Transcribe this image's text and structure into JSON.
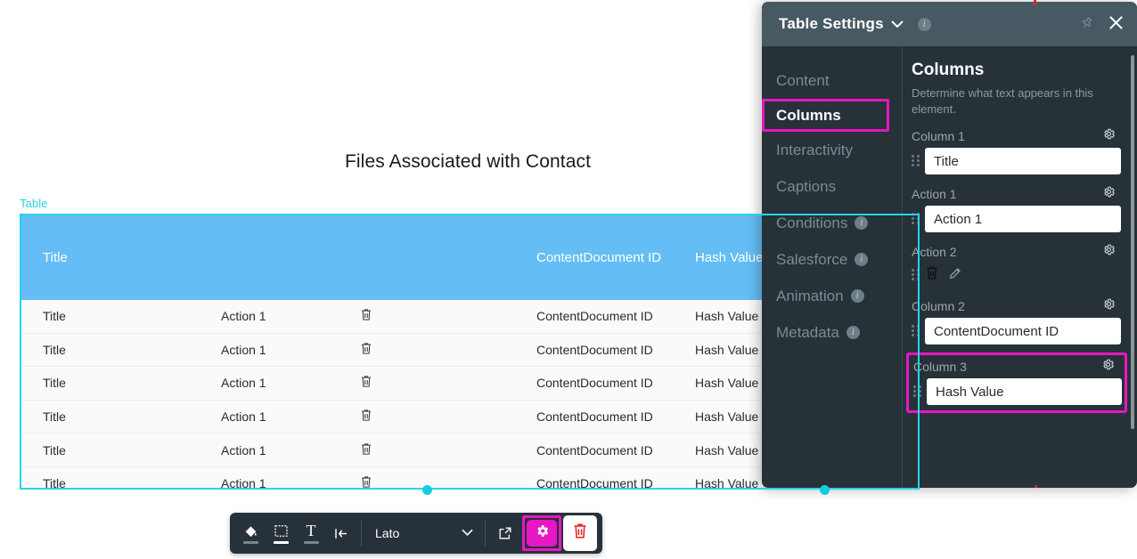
{
  "canvas": {
    "document_title": "Files Associated with Contact",
    "selection_label": "Table",
    "table": {
      "headers": [
        "Title",
        "",
        "",
        "ContentDocument ID",
        "Hash Value"
      ],
      "header_title": "Title",
      "header_contentdocument": "ContentDocument ID",
      "header_hash": "Hash Value",
      "row_count": 6,
      "row": {
        "title": "Title",
        "action1": "Action 1",
        "action2_icon": "trash-icon",
        "contentdocument_id": "ContentDocument ID",
        "hash_value": "Hash Value"
      },
      "header_bg": "#64bdf5",
      "selection_color": "#25d4e8"
    }
  },
  "toolbar": {
    "buttons": [
      {
        "name": "fill-color",
        "icon": "paint-bucket-icon",
        "glyph": "◢",
        "active": false
      },
      {
        "name": "border",
        "icon": "border-box-icon",
        "glyph": "□",
        "active": true
      },
      {
        "name": "text-color",
        "icon": "text-color-icon",
        "glyph": "T",
        "active": false
      },
      {
        "name": "indent",
        "icon": "indent-left-icon",
        "glyph": "|←",
        "active": false
      }
    ],
    "font_value": "Lato",
    "chevron": "⌄",
    "open_external_icon": "external-link-icon",
    "settings_icon": "gear-icon",
    "delete_icon": "trash-icon",
    "accent_color": "#e916c4"
  },
  "panel": {
    "title": "Table Settings",
    "title_chevron": "⌄",
    "info_badge": "i",
    "pin_icon": "pin-icon",
    "close_icon": "close-icon",
    "nav": [
      {
        "label": "Content",
        "active": false,
        "info": false
      },
      {
        "label": "Columns",
        "active": true,
        "info": false
      },
      {
        "label": "Interactivity",
        "active": false,
        "info": false
      },
      {
        "label": "Captions",
        "active": false,
        "info": false
      },
      {
        "label": "Conditions",
        "active": false,
        "info": true
      },
      {
        "label": "Salesforce",
        "active": false,
        "info": true
      },
      {
        "label": "Animation",
        "active": false,
        "info": true
      },
      {
        "label": "Metadata",
        "active": false,
        "info": true
      }
    ],
    "content": {
      "heading": "Columns",
      "description": "Determine what text appears in this element.",
      "fields": [
        {
          "label": "Column 1",
          "value": "Title",
          "type": "text",
          "highlighted": false
        },
        {
          "label": "Action 1",
          "value": "Action 1",
          "type": "text",
          "highlighted": false
        },
        {
          "label": "Action 2",
          "value": "",
          "type": "icons",
          "highlighted": false,
          "icons": [
            "trash-icon",
            "pencil-icon"
          ]
        },
        {
          "label": "Column 2",
          "value": "ContentDocument ID",
          "type": "text",
          "highlighted": false
        },
        {
          "label": "Column 3",
          "value": "Hash Value",
          "type": "text",
          "highlighted": true
        }
      ],
      "gear_icon": "gear-icon",
      "drag_handle_icon": "drag-handle-icon"
    }
  }
}
